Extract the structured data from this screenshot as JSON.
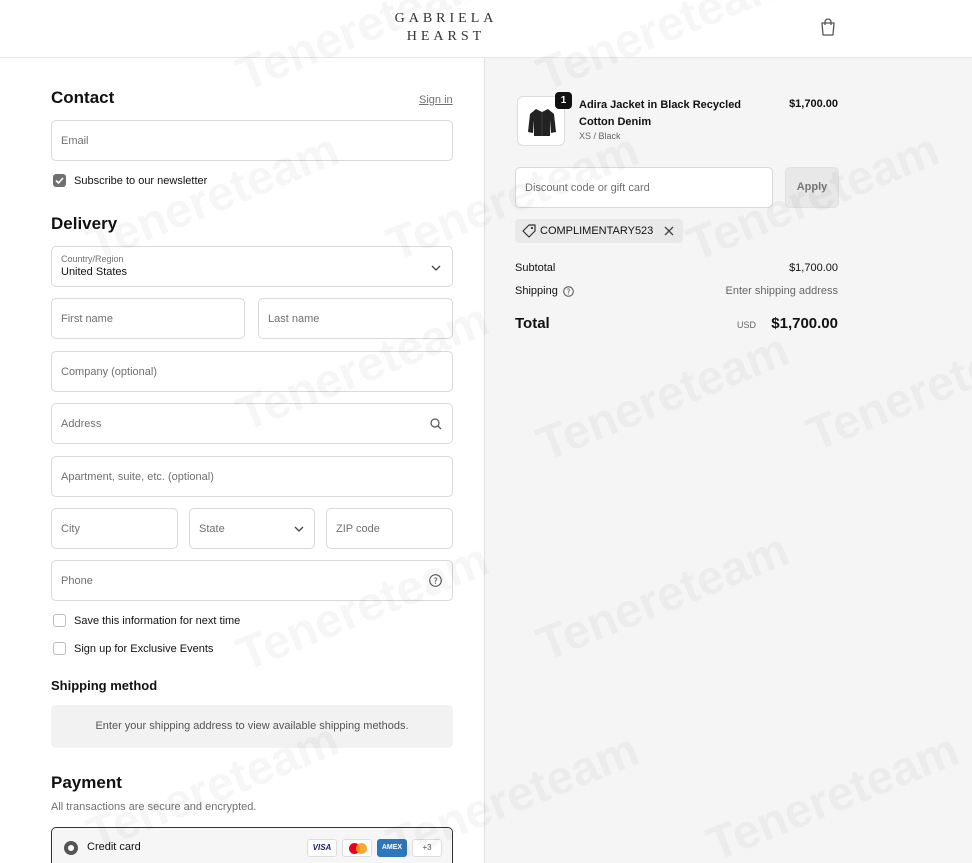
{
  "header": {
    "logo_line1": "GABRIELA",
    "logo_line2": "HEARST",
    "bag_icon": "shopping-bag-icon"
  },
  "contact": {
    "title": "Contact",
    "sign_in": "Sign in",
    "email_placeholder": "Email",
    "newsletter_label": "Subscribe to our newsletter",
    "newsletter_checked": true
  },
  "delivery": {
    "title": "Delivery",
    "country_label": "Country/Region",
    "country_value": "United States",
    "first_name": "First name",
    "last_name": "Last name",
    "company": "Company (optional)",
    "address": "Address",
    "apartment": "Apartment, suite, etc. (optional)",
    "city": "City",
    "state": "State",
    "zip": "ZIP code",
    "phone": "Phone",
    "save_info_label": "Save this information for next time",
    "exclusive_events_label": "Sign up for Exclusive Events"
  },
  "shipping_method": {
    "title": "Shipping method",
    "notice": "Enter your shipping address to view available shipping methods."
  },
  "payment": {
    "title": "Payment",
    "subtitle": "All transactions are secure and encrypted.",
    "method_label": "Credit card",
    "cards": [
      "VISA",
      "MC",
      "AMEX",
      "+3"
    ]
  },
  "summary": {
    "item": {
      "quantity": "1",
      "name": "Adira Jacket in Black Recycled Cotton Denim",
      "variant": "XS / Black",
      "price": "$1,700.00"
    },
    "discount_placeholder": "Discount code or gift card",
    "apply_label": "Apply",
    "applied_code": "COMPLIMENTARY523",
    "subtotal_label": "Subtotal",
    "subtotal_value": "$1,700.00",
    "shipping_label": "Shipping",
    "shipping_value": "Enter shipping address",
    "total_label": "Total",
    "total_currency": "USD",
    "total_value": "$1,700.00"
  },
  "watermark_text": "Tenereteam",
  "colors": {
    "right_bg": "#f5f5f5",
    "border": "#d9d9d9",
    "checkbox_checked": "#707070",
    "amex_blue": "#2e77bc",
    "mc_red": "#eb001b",
    "mc_orange": "#f79e1b",
    "visa_blue": "#1a1f71"
  }
}
